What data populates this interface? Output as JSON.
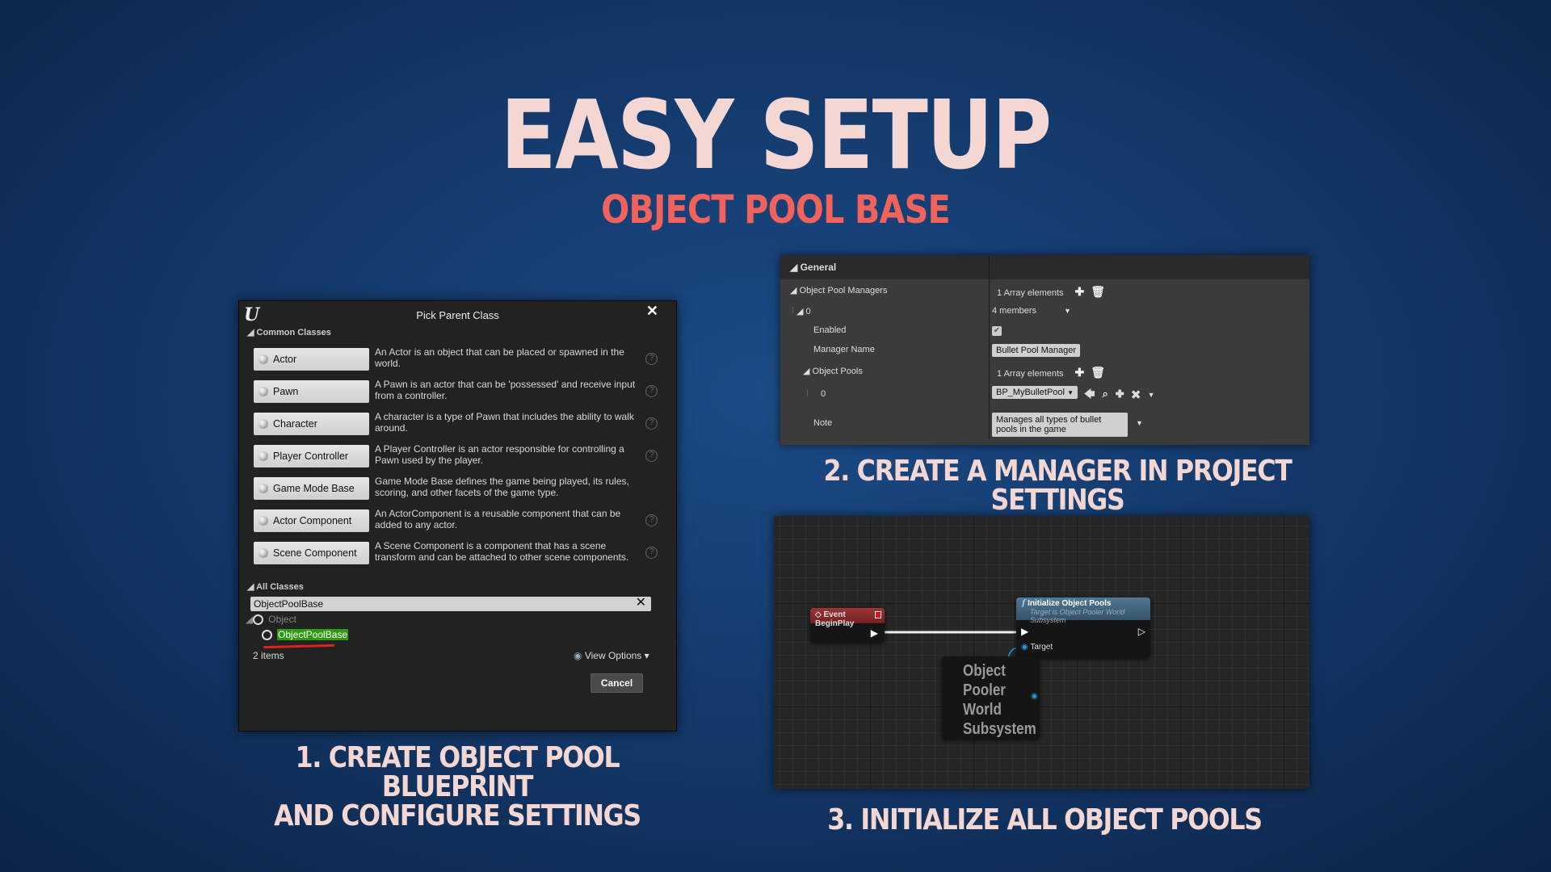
{
  "hero": {
    "title": "EASY SETUP",
    "subtitle": "OBJECT POOL BASE"
  },
  "colors": {
    "title": "#f4d7d2",
    "subtitle": "#f2625c",
    "highlight": "#2e9a10",
    "underline": "#e0201c",
    "pin": "#1e9be0"
  },
  "captions": {
    "step1_line1": "1. CREATE OBJECT POOL BLUEPRINT",
    "step1_line2": "AND CONFIGURE SETTINGS",
    "step2": "2. CREATE A MANAGER IN PROJECT SETTINGS",
    "step3": "3. INITIALIZE ALL OBJECT POOLS"
  },
  "dialog": {
    "title": "Pick Parent Class",
    "common_header": "Common Classes",
    "classes": [
      {
        "label": "Actor",
        "desc": "An Actor is an object that can be placed or spawned in the world."
      },
      {
        "label": "Pawn",
        "desc": "A Pawn is an actor that can be 'possessed' and receive input from a controller."
      },
      {
        "label": "Character",
        "desc": "A character is a type of Pawn that includes the ability to walk around."
      },
      {
        "label": "Player Controller",
        "desc": "A Player Controller is an actor responsible for controlling a Pawn used by the player."
      },
      {
        "label": "Game Mode Base",
        "desc": "Game Mode Base defines the game being played, its rules, scoring, and other facets of the game type."
      },
      {
        "label": "Actor Component",
        "desc": "An ActorComponent is a reusable component that can be added to any actor."
      },
      {
        "label": "Scene Component",
        "desc": "A Scene Component is a component that has a scene transform and can be attached to other scene components."
      }
    ],
    "help_glyph": "?",
    "all_header": "All Classes",
    "search_value": "ObjectPoolBase",
    "tree": {
      "parent": "Object",
      "child": "ObjectPoolBase"
    },
    "count": "2 items",
    "view_options": "View Options",
    "cancel": "Cancel"
  },
  "settings": {
    "section": "General",
    "rows": [
      {
        "key": "Object Pool Managers",
        "value": "1 Array elements"
      },
      {
        "key": "0",
        "value": "4 members"
      },
      {
        "key": "Enabled",
        "checked": true
      },
      {
        "key": "Manager Name",
        "value": "Bullet Pool Manager"
      },
      {
        "key": "Object Pools",
        "value": "1 Array elements"
      },
      {
        "key": "0",
        "value": "BP_MyBulletPool"
      },
      {
        "key": "Note",
        "value": "Manages all types of bullet pools in the game"
      }
    ]
  },
  "graph": {
    "event_node": "Event BeginPlay",
    "function_node": {
      "title": "Initialize Object Pools",
      "subtitle": "Target is Object Pooler World Subsystem",
      "pin": "Target"
    },
    "getter_node": "Object Pooler World Subsystem"
  }
}
